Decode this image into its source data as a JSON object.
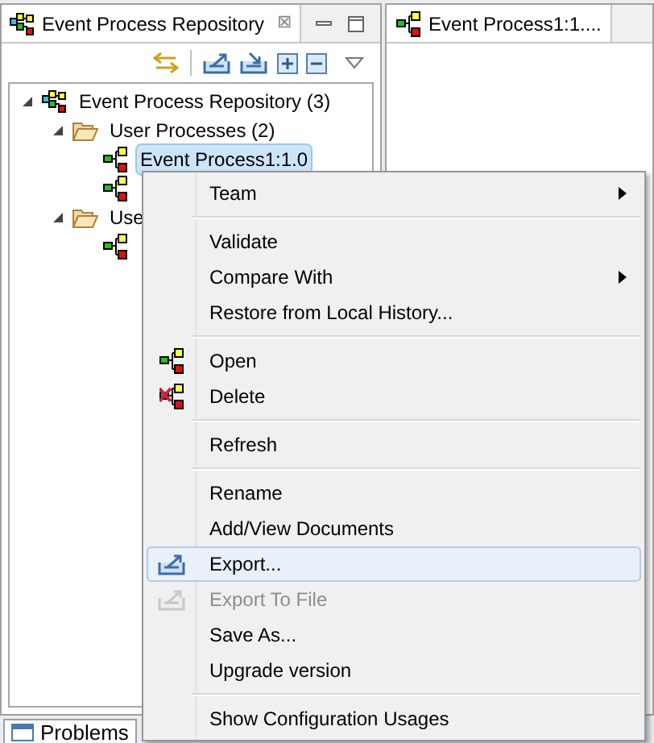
{
  "left_panel": {
    "tab": {
      "title": "Event Process Repository",
      "close": "⊠"
    },
    "tree": [
      {
        "label": "Event Process Repository (3)",
        "kind": "repository",
        "expanded": true,
        "children": [
          {
            "label": "User Processes (2)",
            "kind": "folder",
            "expanded": true,
            "children": [
              {
                "label": "Event Process1:1.0",
                "kind": "process",
                "selected": true
              },
              {
                "kind": "process",
                "selected": false
              }
            ]
          },
          {
            "label": "Use",
            "kind": "folder",
            "expanded": true,
            "children": [
              {
                "kind": "process",
                "selected": false
              }
            ]
          }
        ]
      }
    ]
  },
  "editor_tab": {
    "title": "Event Process1:1...."
  },
  "bottom_tab": {
    "title": "Problems"
  },
  "context_menu": [
    {
      "kind": "submenu",
      "label": "Team"
    },
    {
      "kind": "separator"
    },
    {
      "kind": "plain",
      "label": "Validate"
    },
    {
      "kind": "submenu",
      "label": "Compare With"
    },
    {
      "kind": "plain",
      "label": "Restore from Local History..."
    },
    {
      "kind": "separator"
    },
    {
      "kind": "process",
      "label": "Open"
    },
    {
      "kind": "delete",
      "label": "Delete"
    },
    {
      "kind": "separator"
    },
    {
      "kind": "plain",
      "label": "Refresh"
    },
    {
      "kind": "separator"
    },
    {
      "kind": "plain",
      "label": "Rename"
    },
    {
      "kind": "plain",
      "label": "Add/View Documents"
    },
    {
      "kind": "export",
      "label": "Export...",
      "selected": true
    },
    {
      "kind": "export",
      "label": "Export To File",
      "disabled": true
    },
    {
      "kind": "plain",
      "label": "Save As..."
    },
    {
      "kind": "plain",
      "label": "Upgrade version"
    },
    {
      "kind": "separator"
    },
    {
      "kind": "plain",
      "label": "Show Configuration Usages"
    }
  ]
}
